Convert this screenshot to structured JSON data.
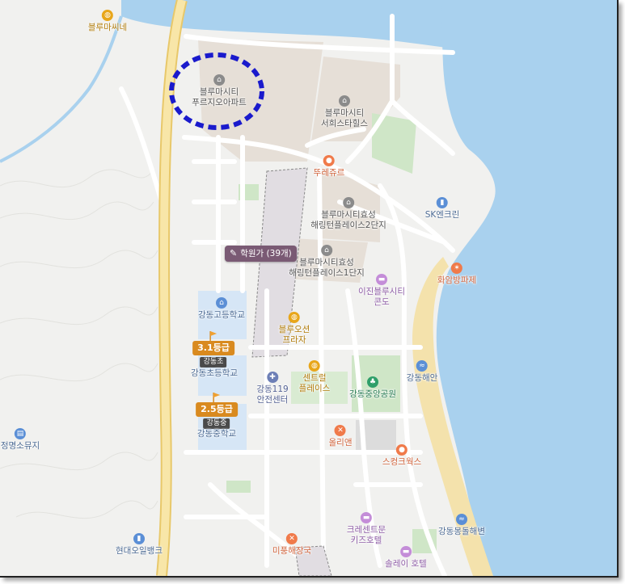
{
  "map": {
    "colors": {
      "land": "#f1f1ef",
      "sea": "#a9d1ee",
      "river": "#a9d1ee",
      "road": "#ffffff",
      "main_road": "#f6d98a",
      "park": "#cfe6c7",
      "beach": "#f4e2ac",
      "school": "#d6e6f6",
      "apartment_block": "#e6dfd7",
      "highlight_ring": "#1a1acc"
    },
    "pois": [
      {
        "id": "blue-market",
        "label": "블루마씨네",
        "icon": "shopping-icon",
        "color": "yellow"
      },
      {
        "id": "bluemacity-prugio",
        "label": "블루마시티\n푸르지오아파트",
        "icon": "apartment-icon",
        "color": "gray"
      },
      {
        "id": "bluemacity-seohui",
        "label": "블루마시티\n서희스타힐스",
        "icon": "apartment-icon",
        "color": "gray"
      },
      {
        "id": "tous-les-jours",
        "label": "뚜레쥬르",
        "icon": "bakery-icon",
        "color": "orange"
      },
      {
        "id": "sk-encline",
        "label": "SK엔크린",
        "icon": "gas-station-icon",
        "color": "blue"
      },
      {
        "id": "hyosung-2",
        "label": "블루마시티효성\n해링턴플레이스2단지",
        "icon": "apartment-icon",
        "color": "gray"
      },
      {
        "id": "hyosung-1",
        "label": "블루마시티효성\n해링턴플레이스1단지",
        "icon": "apartment-icon",
        "color": "gray"
      },
      {
        "id": "hwaam-breakwater",
        "label": "화암방파제",
        "icon": "breakwater-icon",
        "color": "orange"
      },
      {
        "id": "ijin-condo",
        "label": "이진블루시티\n콘도",
        "icon": "hotel-icon",
        "color": "purple"
      },
      {
        "id": "gangdong-high",
        "label": "강동고등학교",
        "icon": "school-icon",
        "color": "blue"
      },
      {
        "id": "blue-ocean-plaza",
        "label": "블루오션\n프라자",
        "icon": "shopping-icon",
        "color": "yellow"
      },
      {
        "id": "gangdong-elem",
        "label": "강동초등학교",
        "icon": "school-icon",
        "color": "blue"
      },
      {
        "id": "gangdong-119",
        "label": "강동119\n안전센터",
        "icon": "fire-station-icon",
        "color": "navy"
      },
      {
        "id": "central-place",
        "label": "센트럴\n플레이스",
        "icon": "shopping-icon",
        "color": "yellow"
      },
      {
        "id": "gangdong-park",
        "label": "강동중앙공원",
        "icon": "park-icon",
        "color": "green"
      },
      {
        "id": "gangdong-beach",
        "label": "강동해안",
        "icon": "beach-icon",
        "color": "blue"
      },
      {
        "id": "gangdong-middle",
        "label": "강동중학교",
        "icon": "school-icon",
        "color": "blue"
      },
      {
        "id": "jeongmyeong-museum",
        "label": "정명소뮤지",
        "icon": "museum-icon",
        "color": "blue"
      },
      {
        "id": "olien",
        "label": "올리앤",
        "icon": "restaurant-icon",
        "color": "orange"
      },
      {
        "id": "scrub-works",
        "label": "스컹크웍스",
        "icon": "cafe-icon",
        "color": "orange"
      },
      {
        "id": "crescent-moon-hotel",
        "label": "크레센트문\n키즈호텔",
        "icon": "hotel-icon",
        "color": "purple"
      },
      {
        "id": "gangdong-mongdol",
        "label": "강동몽돌해변",
        "icon": "beach-icon",
        "color": "blue"
      },
      {
        "id": "hyundai-oilbank",
        "label": "현대오일뱅크",
        "icon": "gas-station-icon",
        "color": "blue"
      },
      {
        "id": "mipung-haejangguk",
        "label": "미풍해장국",
        "icon": "restaurant-icon",
        "color": "orange"
      },
      {
        "id": "solei-hotel",
        "label": "솔레이 호텔",
        "icon": "hotel-icon",
        "color": "purple"
      }
    ],
    "academy_badge": {
      "label": "학원가 (39개)",
      "icon": "pencil-icon"
    },
    "school_grades": [
      {
        "grade": "3.1등급",
        "school_tag": "강동초"
      },
      {
        "grade": "2.5등급",
        "school_tag": "강동중"
      }
    ]
  }
}
